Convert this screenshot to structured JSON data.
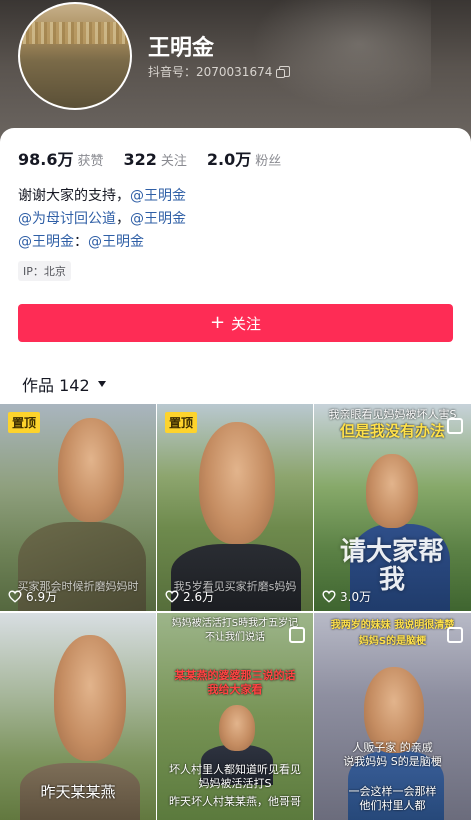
{
  "profile": {
    "name": "王明金",
    "douyin_id": "抖音号：2070031674"
  },
  "stats": [
    {
      "num": "98.6万",
      "label": "获赞"
    },
    {
      "num": "322",
      "label": "关注"
    },
    {
      "num": "2.0万",
      "label": "粉丝"
    }
  ],
  "bio": {
    "line1_text": "谢谢大家的支持，",
    "line1_mention": "@王明金",
    "line2_mention_a": "@为母讨回公道",
    "line2_sep": "，",
    "line2_mention_b": "@王明金",
    "line3_mention_a": "@王明金",
    "line3_sep": "：",
    "line3_mention_b": "@王明金"
  },
  "ip": "IP：北京",
  "follow_button": {
    "plus": "+",
    "label": "关注"
  },
  "works": {
    "label": "作品 142"
  },
  "videos": [
    {
      "pinned": "置顶",
      "likes": "6.9万",
      "caption": "买家那会时候折磨妈妈时"
    },
    {
      "pinned": "置顶",
      "likes": "2.6万",
      "caption": "我5岁看见买家折磨s妈妈"
    },
    {
      "likes": "3.0万",
      "top_a": "我亲眼看见妈妈被坏人害S",
      "top_b": "但是我没有办法",
      "big": "请大家帮我"
    },
    {
      "caption": "昨天某某燕"
    },
    {
      "top_a": "妈妈被活活打S時我才五岁记",
      "top_b": "不让我们说话",
      "mid_a": "某某燕的婆婆那三说的话",
      "mid_b": "我给大家看",
      "bottom_a": "坏人村里人都知道听见看见",
      "bottom_b": "妈妈被活活打S",
      "bottom_c": "昨天坏人村某某燕，他哥哥"
    },
    {
      "top_a": "我两岁的妹妹  我说明很清楚",
      "top_b": "妈妈S的是脑梗",
      "mid_a": "人贩子家  的亲戚",
      "mid_b": "说我妈妈  S的是脑梗",
      "bottom_a": "一会这样一会那样",
      "bottom_b": "他们村里人都"
    }
  ],
  "colors": {
    "accent": "#fe2c55",
    "mention": "#2f5fa6",
    "pin": "#fdd32c"
  }
}
